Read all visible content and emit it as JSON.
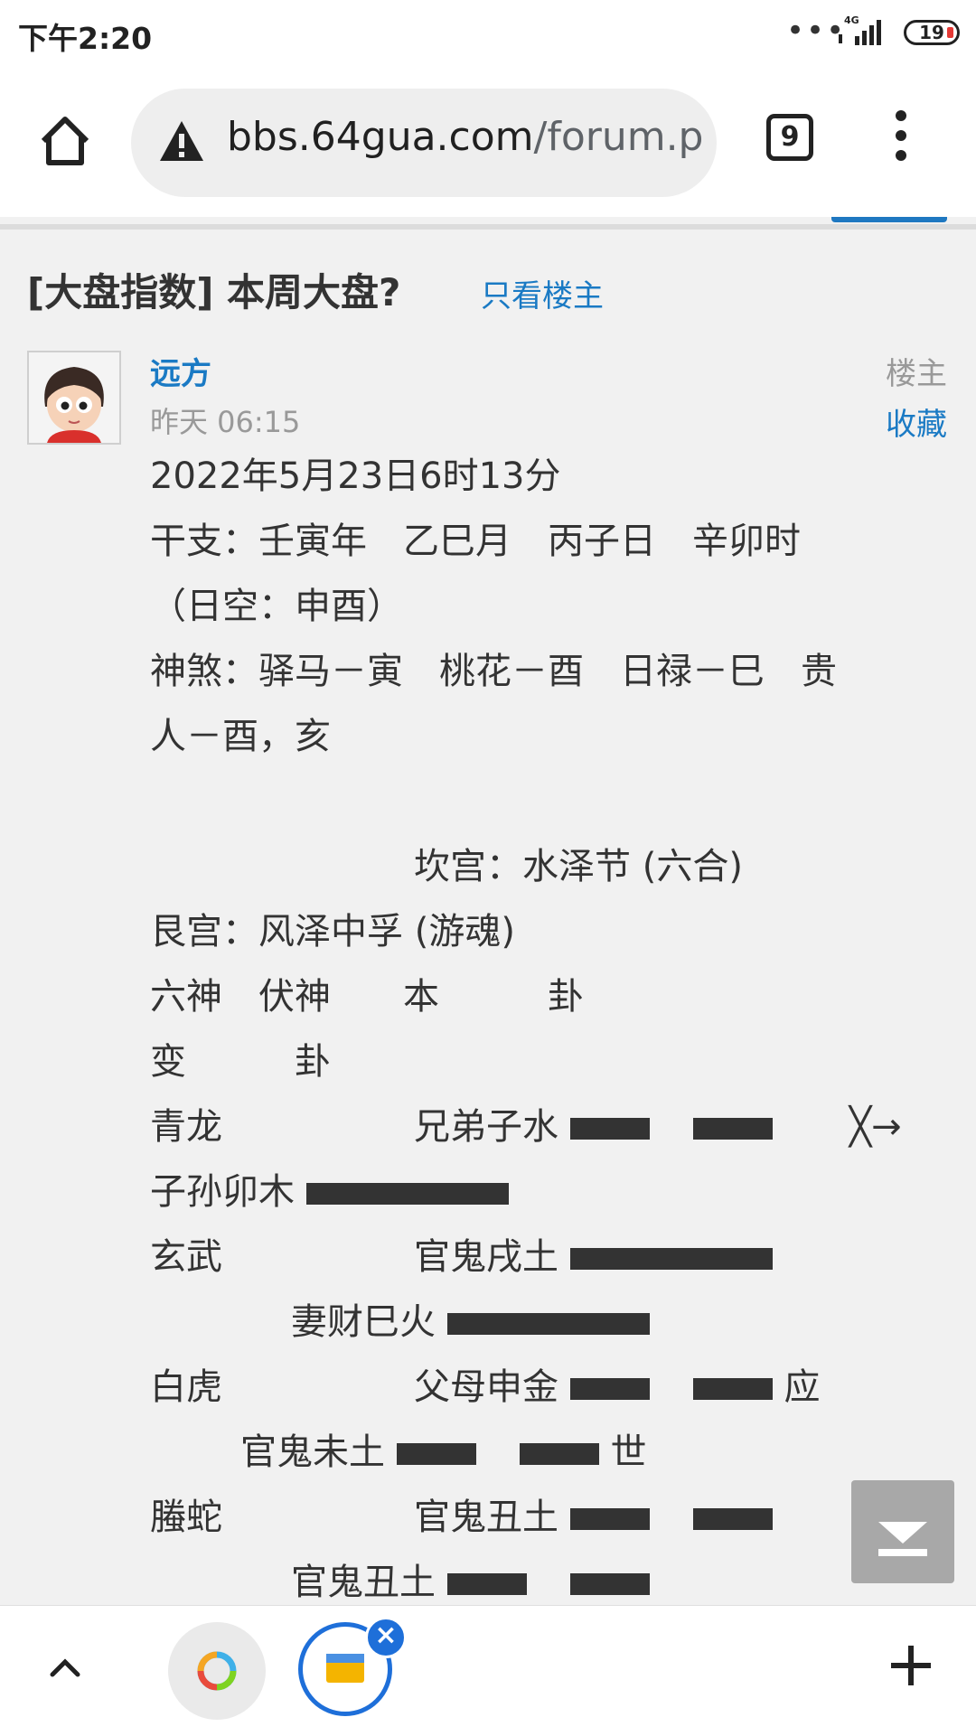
{
  "status_bar": {
    "time": "下午2:20",
    "network": "4G",
    "battery": "19"
  },
  "browser": {
    "url_host": "bbs.64gua.com",
    "url_path": "/forum.p",
    "tab_count": "9",
    "icons": [
      "home-icon",
      "warning-icon",
      "tabs-icon",
      "more-vert-icon",
      "chevron-up-icon",
      "plus-icon",
      "close-icon"
    ]
  },
  "thread": {
    "title": "[大盘指数] 本周大盘?",
    "only_op_link": "只看楼主"
  },
  "post": {
    "author": "远方",
    "time": "昨天 06:15",
    "op_label": "楼主",
    "favorite_label": "收藏",
    "lines": [
      "2022年5月23日6时13分",
      "干支：壬寅年　乙巳月　丙子日　辛卯时",
      "（日空：申酉）",
      "神煞：驿马－寅　桃花－酉　日禄－巳　贵",
      "人－酉，亥",
      "坎宫：水泽节 (六合)",
      "艮宫：风泽中孚 (游魂)",
      "六神　伏神　　本　　　卦",
      "变　　　卦",
      "青龙",
      "兄弟子水",
      "╳→",
      "子孙卯木",
      "玄武",
      "官鬼戌土",
      "妻财巳火",
      "白虎",
      "父母申金",
      "应",
      "官鬼未土",
      "世",
      "螣蛇",
      "官鬼丑土",
      "官鬼丑土"
    ]
  }
}
